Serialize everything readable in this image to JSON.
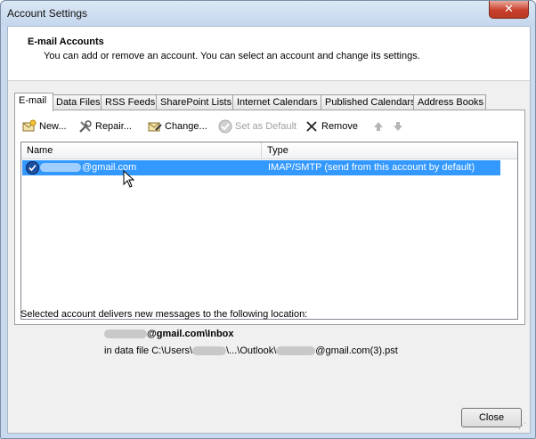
{
  "window": {
    "title": "Account Settings",
    "close_glyph": "✕"
  },
  "header": {
    "title": "E-mail Accounts",
    "description": "You can add or remove an account. You can select an account and change its settings."
  },
  "tabs": [
    {
      "label": "E-mail"
    },
    {
      "label": "Data Files"
    },
    {
      "label": "RSS Feeds"
    },
    {
      "label": "SharePoint Lists"
    },
    {
      "label": "Internet Calendars"
    },
    {
      "label": "Published Calendars"
    },
    {
      "label": "Address Books"
    }
  ],
  "toolbar": {
    "new_label": "New...",
    "repair_label": "Repair...",
    "change_label": "Change...",
    "default_label": "Set as Default",
    "remove_label": "Remove"
  },
  "list": {
    "columns": [
      "Name",
      "Type"
    ],
    "rows": [
      {
        "name": "@gmail.com",
        "type": "IMAP/SMTP (send from this account by default)"
      }
    ]
  },
  "delivery": {
    "label": "Selected account delivers new messages to the following location:",
    "folder": "@gmail.com\\Inbox",
    "file_prefix": "in data file C:\\Users\\",
    "file_mid": "\\...\\Outlook\\",
    "file_suffix": "@gmail.com(3).pst"
  },
  "footer": {
    "close_label": "Close"
  },
  "colors": {
    "selection": "#3399ff",
    "title_bar": "#c9daee",
    "close_button": "#c8402c"
  }
}
